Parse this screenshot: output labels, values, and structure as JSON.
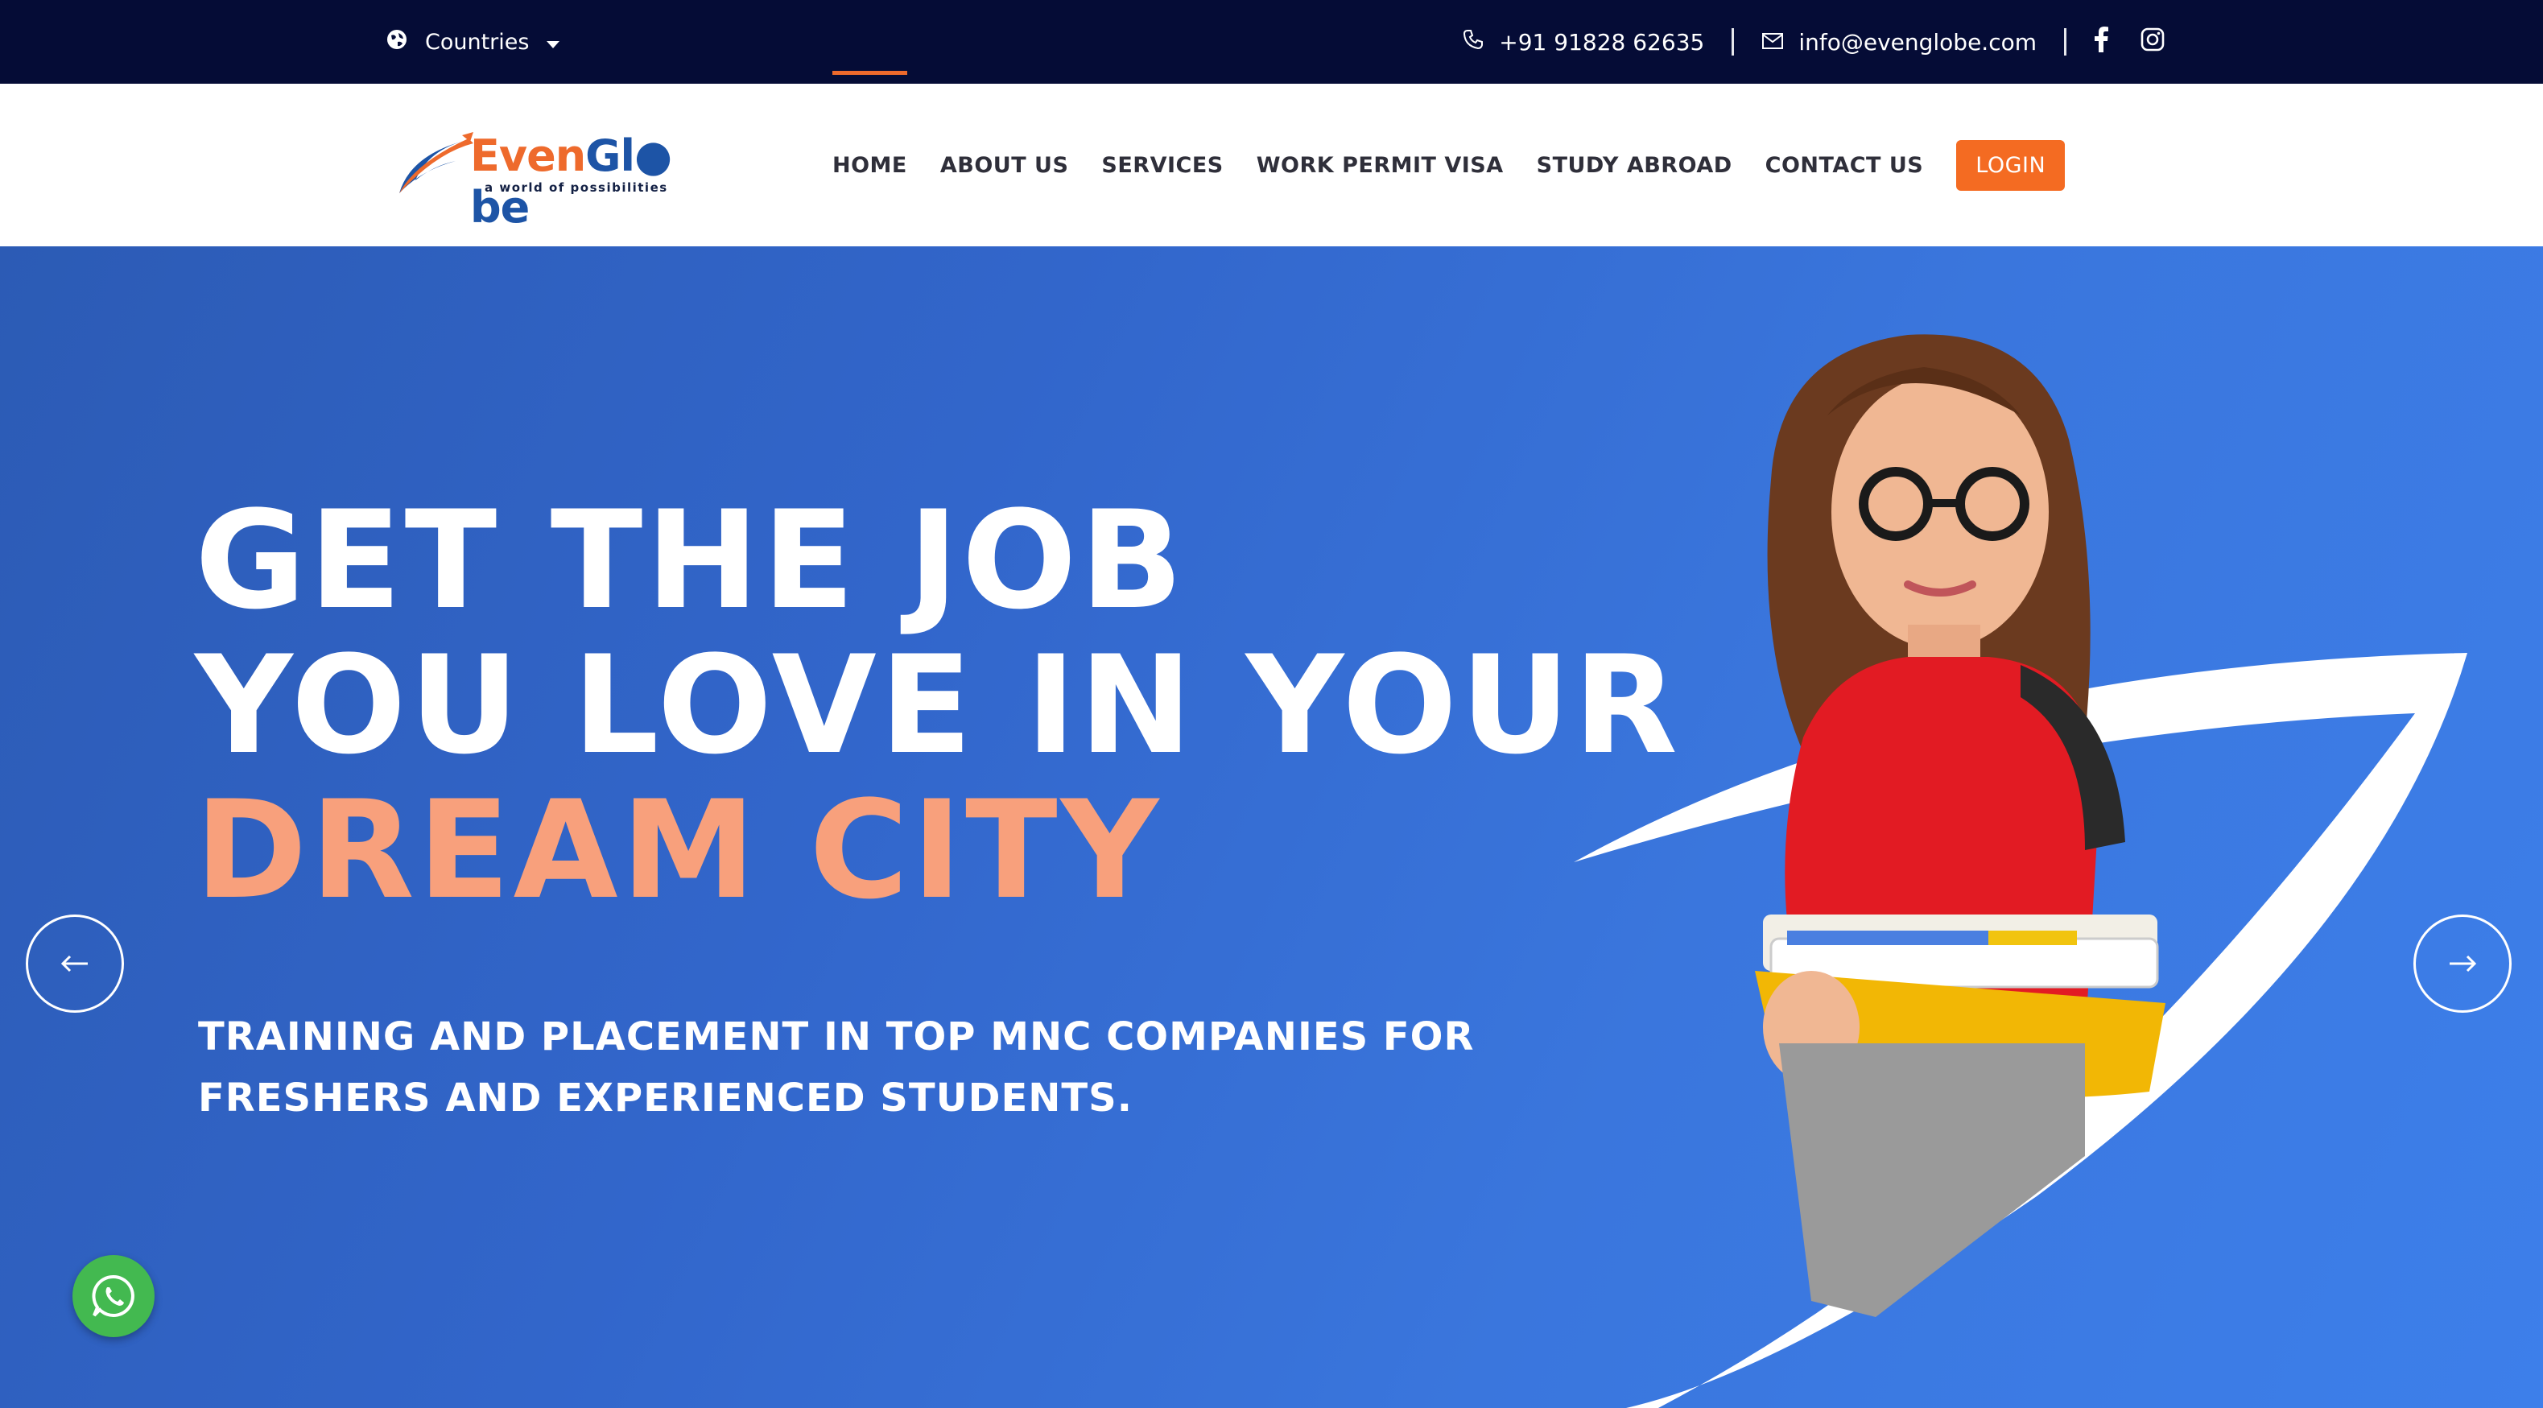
{
  "topbar": {
    "countries_label": "Countries",
    "phone": "+91 91828 62635",
    "email": "info@evenglobe.com",
    "icons": [
      "globe-icon",
      "caret-down-icon",
      "phone-icon",
      "mail-icon",
      "facebook-icon",
      "instagram-icon"
    ]
  },
  "logo": {
    "brand_part1": "Even",
    "brand_part2": "Gl",
    "brand_part3": "be",
    "tagline": "a world of possibilities"
  },
  "nav": {
    "items": [
      "HOME",
      "ABOUT US",
      "SERVICES",
      "WORK PERMIT VISA",
      "STUDY ABROAD",
      "CONTACT US"
    ],
    "active": "HOME",
    "login": "LOGIN"
  },
  "hero": {
    "headline_line1": "GET THE JOB",
    "headline_line2": "YOU LOVE IN YOUR",
    "headline_line3": "DREAM CITY",
    "subheading_line1": "TRAINING AND PLACEMENT IN TOP MNC COMPANIES FOR",
    "subheading_line2": "FRESHERS AND EXPERIENCED STUDENTS."
  },
  "colors": {
    "topbar_bg": "#050c36",
    "accent_orange": "#f46b22",
    "brand_blue": "#1d54a6",
    "hero_blue": "#3266cb",
    "headline_highlight": "#f8a07c",
    "whatsapp_green": "#43b950"
  }
}
